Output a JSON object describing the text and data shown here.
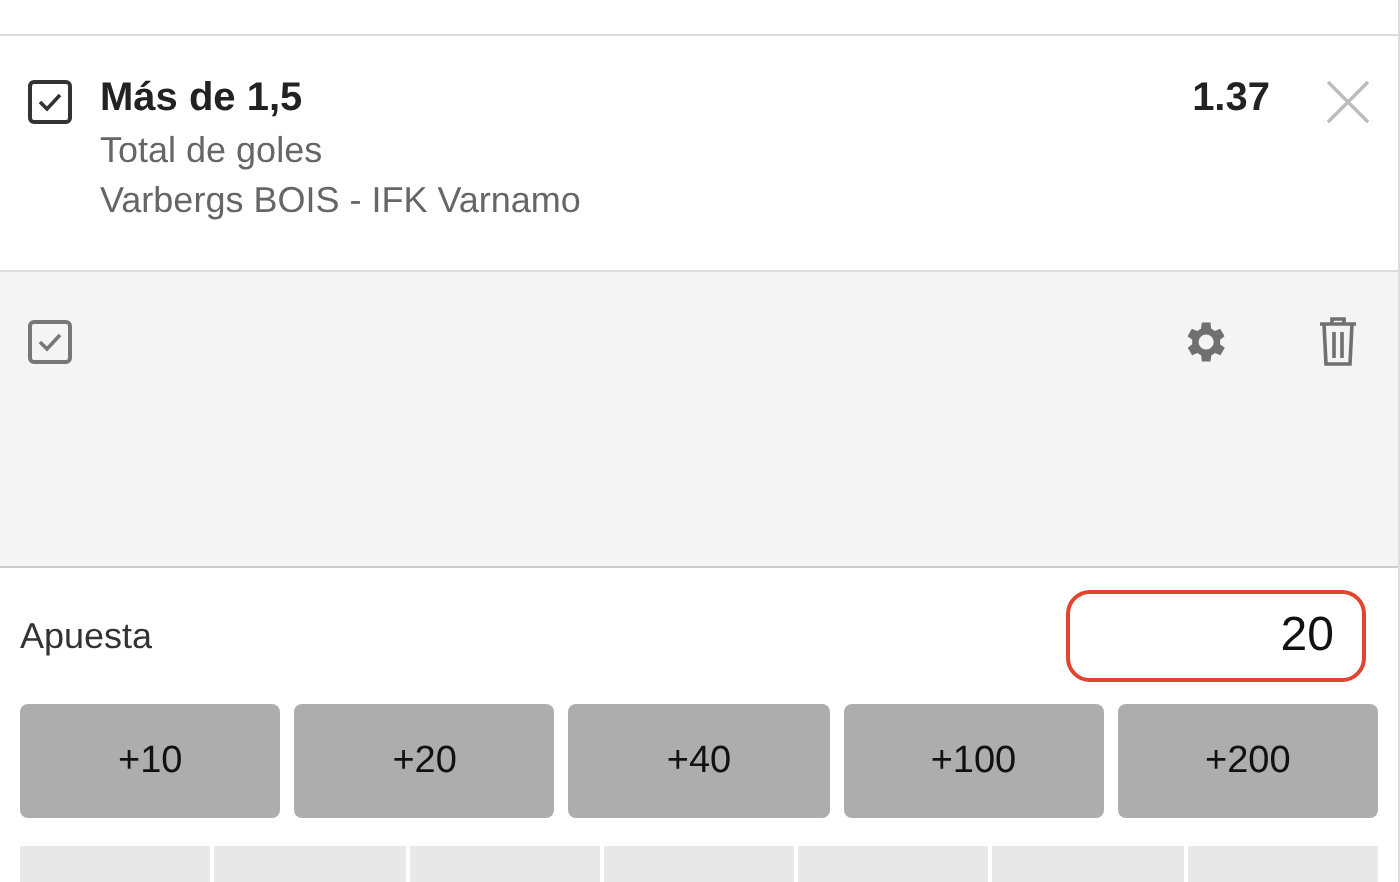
{
  "selection": {
    "checked": true,
    "title": "Más de 1,5",
    "odds": "1.37",
    "market": "Total de goles",
    "event": "Varbergs BOIS - IFK Varnamo"
  },
  "panel": {
    "select_all_checked": true
  },
  "stake": {
    "label": "Apuesta",
    "value": "20"
  },
  "quick_amounts": [
    "+10",
    "+20",
    "+40",
    "+100",
    "+200"
  ]
}
